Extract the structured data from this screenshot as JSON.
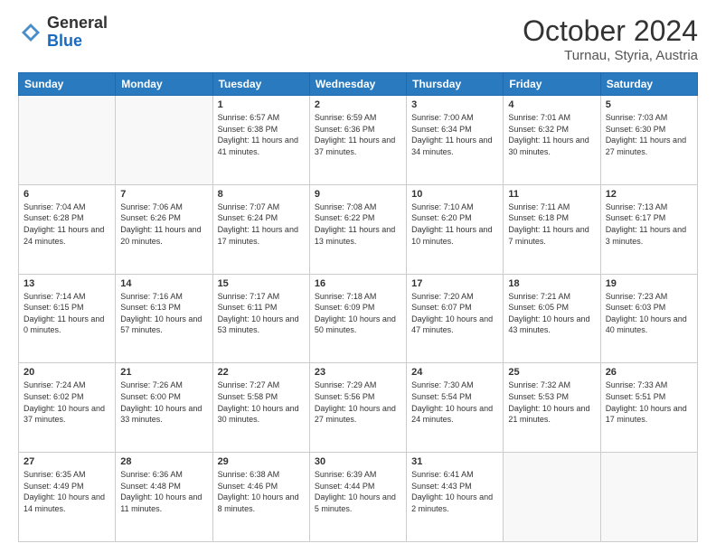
{
  "logo": {
    "general": "General",
    "blue": "Blue"
  },
  "title": "October 2024",
  "location": "Turnau, Styria, Austria",
  "days_of_week": [
    "Sunday",
    "Monday",
    "Tuesday",
    "Wednesday",
    "Thursday",
    "Friday",
    "Saturday"
  ],
  "weeks": [
    [
      {
        "day": "",
        "info": ""
      },
      {
        "day": "",
        "info": ""
      },
      {
        "day": "1",
        "info": "Sunrise: 6:57 AM\nSunset: 6:38 PM\nDaylight: 11 hours and 41 minutes."
      },
      {
        "day": "2",
        "info": "Sunrise: 6:59 AM\nSunset: 6:36 PM\nDaylight: 11 hours and 37 minutes."
      },
      {
        "day": "3",
        "info": "Sunrise: 7:00 AM\nSunset: 6:34 PM\nDaylight: 11 hours and 34 minutes."
      },
      {
        "day": "4",
        "info": "Sunrise: 7:01 AM\nSunset: 6:32 PM\nDaylight: 11 hours and 30 minutes."
      },
      {
        "day": "5",
        "info": "Sunrise: 7:03 AM\nSunset: 6:30 PM\nDaylight: 11 hours and 27 minutes."
      }
    ],
    [
      {
        "day": "6",
        "info": "Sunrise: 7:04 AM\nSunset: 6:28 PM\nDaylight: 11 hours and 24 minutes."
      },
      {
        "day": "7",
        "info": "Sunrise: 7:06 AM\nSunset: 6:26 PM\nDaylight: 11 hours and 20 minutes."
      },
      {
        "day": "8",
        "info": "Sunrise: 7:07 AM\nSunset: 6:24 PM\nDaylight: 11 hours and 17 minutes."
      },
      {
        "day": "9",
        "info": "Sunrise: 7:08 AM\nSunset: 6:22 PM\nDaylight: 11 hours and 13 minutes."
      },
      {
        "day": "10",
        "info": "Sunrise: 7:10 AM\nSunset: 6:20 PM\nDaylight: 11 hours and 10 minutes."
      },
      {
        "day": "11",
        "info": "Sunrise: 7:11 AM\nSunset: 6:18 PM\nDaylight: 11 hours and 7 minutes."
      },
      {
        "day": "12",
        "info": "Sunrise: 7:13 AM\nSunset: 6:17 PM\nDaylight: 11 hours and 3 minutes."
      }
    ],
    [
      {
        "day": "13",
        "info": "Sunrise: 7:14 AM\nSunset: 6:15 PM\nDaylight: 11 hours and 0 minutes."
      },
      {
        "day": "14",
        "info": "Sunrise: 7:16 AM\nSunset: 6:13 PM\nDaylight: 10 hours and 57 minutes."
      },
      {
        "day": "15",
        "info": "Sunrise: 7:17 AM\nSunset: 6:11 PM\nDaylight: 10 hours and 53 minutes."
      },
      {
        "day": "16",
        "info": "Sunrise: 7:18 AM\nSunset: 6:09 PM\nDaylight: 10 hours and 50 minutes."
      },
      {
        "day": "17",
        "info": "Sunrise: 7:20 AM\nSunset: 6:07 PM\nDaylight: 10 hours and 47 minutes."
      },
      {
        "day": "18",
        "info": "Sunrise: 7:21 AM\nSunset: 6:05 PM\nDaylight: 10 hours and 43 minutes."
      },
      {
        "day": "19",
        "info": "Sunrise: 7:23 AM\nSunset: 6:03 PM\nDaylight: 10 hours and 40 minutes."
      }
    ],
    [
      {
        "day": "20",
        "info": "Sunrise: 7:24 AM\nSunset: 6:02 PM\nDaylight: 10 hours and 37 minutes."
      },
      {
        "day": "21",
        "info": "Sunrise: 7:26 AM\nSunset: 6:00 PM\nDaylight: 10 hours and 33 minutes."
      },
      {
        "day": "22",
        "info": "Sunrise: 7:27 AM\nSunset: 5:58 PM\nDaylight: 10 hours and 30 minutes."
      },
      {
        "day": "23",
        "info": "Sunrise: 7:29 AM\nSunset: 5:56 PM\nDaylight: 10 hours and 27 minutes."
      },
      {
        "day": "24",
        "info": "Sunrise: 7:30 AM\nSunset: 5:54 PM\nDaylight: 10 hours and 24 minutes."
      },
      {
        "day": "25",
        "info": "Sunrise: 7:32 AM\nSunset: 5:53 PM\nDaylight: 10 hours and 21 minutes."
      },
      {
        "day": "26",
        "info": "Sunrise: 7:33 AM\nSunset: 5:51 PM\nDaylight: 10 hours and 17 minutes."
      }
    ],
    [
      {
        "day": "27",
        "info": "Sunrise: 6:35 AM\nSunset: 4:49 PM\nDaylight: 10 hours and 14 minutes."
      },
      {
        "day": "28",
        "info": "Sunrise: 6:36 AM\nSunset: 4:48 PM\nDaylight: 10 hours and 11 minutes."
      },
      {
        "day": "29",
        "info": "Sunrise: 6:38 AM\nSunset: 4:46 PM\nDaylight: 10 hours and 8 minutes."
      },
      {
        "day": "30",
        "info": "Sunrise: 6:39 AM\nSunset: 4:44 PM\nDaylight: 10 hours and 5 minutes."
      },
      {
        "day": "31",
        "info": "Sunrise: 6:41 AM\nSunset: 4:43 PM\nDaylight: 10 hours and 2 minutes."
      },
      {
        "day": "",
        "info": ""
      },
      {
        "day": "",
        "info": ""
      }
    ]
  ]
}
